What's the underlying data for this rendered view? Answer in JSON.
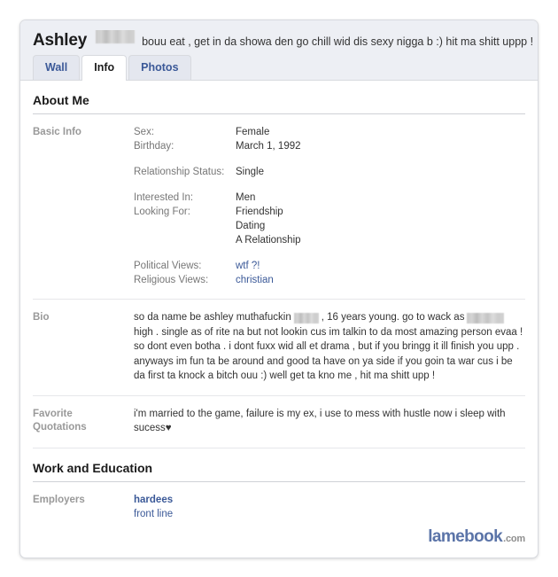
{
  "header": {
    "profile_name": "Ashley",
    "name_redacted": true,
    "status_text": "bouu eat , get in da showa den go chill wid dis sexy nigga b :) hit ma shitt uppp !",
    "tabs": [
      {
        "label": "Wall",
        "active": false
      },
      {
        "label": "Info",
        "active": true
      },
      {
        "label": "Photos",
        "active": false
      }
    ]
  },
  "sections": [
    {
      "title": "About Me"
    },
    {
      "title": "Work and Education"
    }
  ],
  "basic_info": {
    "label": "Basic Info",
    "rows": [
      {
        "key": "Sex:",
        "value": "Female",
        "link": false
      },
      {
        "key": "Birthday:",
        "value": "March 1, 1992",
        "link": false
      },
      {
        "key": "Relationship Status:",
        "value": "Single",
        "link": false
      },
      {
        "key": "Interested In:",
        "value": "Men",
        "link": false
      },
      {
        "key": "Looking For:",
        "value": "Friendship",
        "link": false
      },
      {
        "key": "",
        "value": "Dating",
        "link": false
      },
      {
        "key": "",
        "value": "A Relationship",
        "link": false
      },
      {
        "key": "Political Views:",
        "value": "wtf ?!",
        "link": true
      },
      {
        "key": "Religious Views:",
        "value": "christian",
        "link": true
      }
    ]
  },
  "bio": {
    "label": "Bio",
    "part1": "so da name be ashley muthafuckin",
    "part2": ", 16 years young. go to wack as",
    "part3": "high . single as of rite na but not lookin cus im talkin to da most amazing person evaa ! so dont even botha . i dont fuxx wid all et drama , but if you bringg it ill finish you upp . anyways im fun ta be around and good ta have on ya side if you goin ta war cus i be da first ta knock a bitch ouu :) well get ta kno me , hit ma shitt upp !"
  },
  "quotations": {
    "label_line1": "Favorite",
    "label_line2": "Quotations",
    "text": "i'm married to the game, failure is my ex, i use to mess with hustle now i sleep with sucess♥"
  },
  "employers": {
    "label": "Employers",
    "name": "hardees",
    "position": "front line"
  },
  "watermark": {
    "main": "lamebook",
    "tld": ".com"
  },
  "colors": {
    "link": "#3b5998",
    "header_band": "#edeff4",
    "text": "#333333",
    "label": "#999999"
  }
}
